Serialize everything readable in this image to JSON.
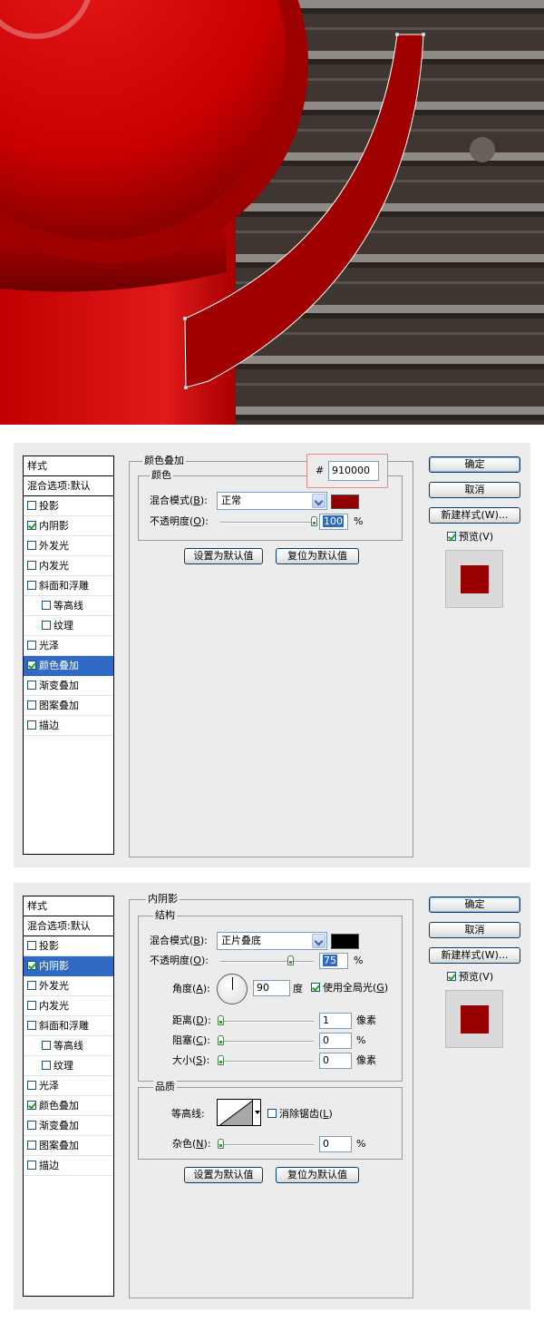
{
  "colors": {
    "accent": "#316ac5",
    "overlay_color": "#910000",
    "shadow_color": "#000000",
    "preview_color": "#990000",
    "artwork_red": "#cc0000",
    "highlight_box": "#e08a8a"
  },
  "color_overlay_dialog": {
    "style_list": {
      "header": "样式",
      "blend_options": "混合选项:默认",
      "items": [
        {
          "label": "投影",
          "checked": false,
          "indent": false,
          "selected": false
        },
        {
          "label": "内阴影",
          "checked": true,
          "indent": false,
          "selected": false
        },
        {
          "label": "外发光",
          "checked": false,
          "indent": false,
          "selected": false
        },
        {
          "label": "内发光",
          "checked": false,
          "indent": false,
          "selected": false
        },
        {
          "label": "斜面和浮雕",
          "checked": false,
          "indent": false,
          "selected": false
        },
        {
          "label": "等高线",
          "checked": false,
          "indent": true,
          "selected": false
        },
        {
          "label": "纹理",
          "checked": false,
          "indent": true,
          "selected": false
        },
        {
          "label": "光泽",
          "checked": false,
          "indent": false,
          "selected": false
        },
        {
          "label": "颜色叠加",
          "checked": true,
          "indent": false,
          "selected": true
        },
        {
          "label": "渐变叠加",
          "checked": false,
          "indent": false,
          "selected": false
        },
        {
          "label": "图案叠加",
          "checked": false,
          "indent": false,
          "selected": false
        },
        {
          "label": "描边",
          "checked": false,
          "indent": false,
          "selected": false
        }
      ]
    },
    "panel_title": "颜色叠加",
    "group_title": "颜色",
    "hex_prefix": "#",
    "hex_value": "910000",
    "blend_mode_label": "混合模式(",
    "blend_mode_key": "B",
    "blend_mode_value": "正常",
    "opacity_label": "不透明度(",
    "opacity_key": "O",
    "opacity_value": "100",
    "opacity_fraction": 1.0,
    "percent": "%",
    "make_default": "设置为默认值",
    "reset_default": "复位为默认值",
    "ok": "确定",
    "cancel": "取消",
    "new_style": "新建样式(W)...",
    "preview": "预览(V)"
  },
  "inner_shadow_dialog": {
    "style_list": {
      "header": "样式",
      "blend_options": "混合选项:默认",
      "items": [
        {
          "label": "投影",
          "checked": false,
          "indent": false,
          "selected": false
        },
        {
          "label": "内阴影",
          "checked": true,
          "indent": false,
          "selected": true
        },
        {
          "label": "外发光",
          "checked": false,
          "indent": false,
          "selected": false
        },
        {
          "label": "内发光",
          "checked": false,
          "indent": false,
          "selected": false
        },
        {
          "label": "斜面和浮雕",
          "checked": false,
          "indent": false,
          "selected": false
        },
        {
          "label": "等高线",
          "checked": false,
          "indent": true,
          "selected": false
        },
        {
          "label": "纹理",
          "checked": false,
          "indent": true,
          "selected": false
        },
        {
          "label": "光泽",
          "checked": false,
          "indent": false,
          "selected": false
        },
        {
          "label": "颜色叠加",
          "checked": true,
          "indent": false,
          "selected": false
        },
        {
          "label": "渐变叠加",
          "checked": false,
          "indent": false,
          "selected": false
        },
        {
          "label": "图案叠加",
          "checked": false,
          "indent": false,
          "selected": false
        },
        {
          "label": "描边",
          "checked": false,
          "indent": false,
          "selected": false
        }
      ]
    },
    "panel_title": "内阴影",
    "structure_title": "结构",
    "blend_mode_label": "混合模式(",
    "blend_mode_key": "B",
    "blend_mode_value": "正片叠底",
    "opacity_label": "不透明度(",
    "opacity_key": "O",
    "opacity_value": "75",
    "opacity_fraction": 0.75,
    "angle_label": "角度(",
    "angle_key": "A",
    "angle_value": "90",
    "degree_unit": "度",
    "global_light": "使用全局光(",
    "global_light_key": "G",
    "distance_label": "距离(",
    "distance_key": "D",
    "distance_value": "1",
    "choke_label": "阻塞(",
    "choke_key": "C",
    "choke_value": "0",
    "size_label": "大小(",
    "size_key": "S",
    "size_value": "0",
    "pixel_unit": "像素",
    "percent": "%",
    "quality_title": "品质",
    "contour_label": "等高线:",
    "anti_alias": "消除锯齿(",
    "anti_alias_key": "L",
    "noise_label": "杂色(",
    "noise_key": "N",
    "noise_value": "0",
    "make_default": "设置为默认值",
    "reset_default": "复位为默认值",
    "ok": "确定",
    "cancel": "取消",
    "new_style": "新建样式(W)...",
    "preview": "预览(V)"
  }
}
